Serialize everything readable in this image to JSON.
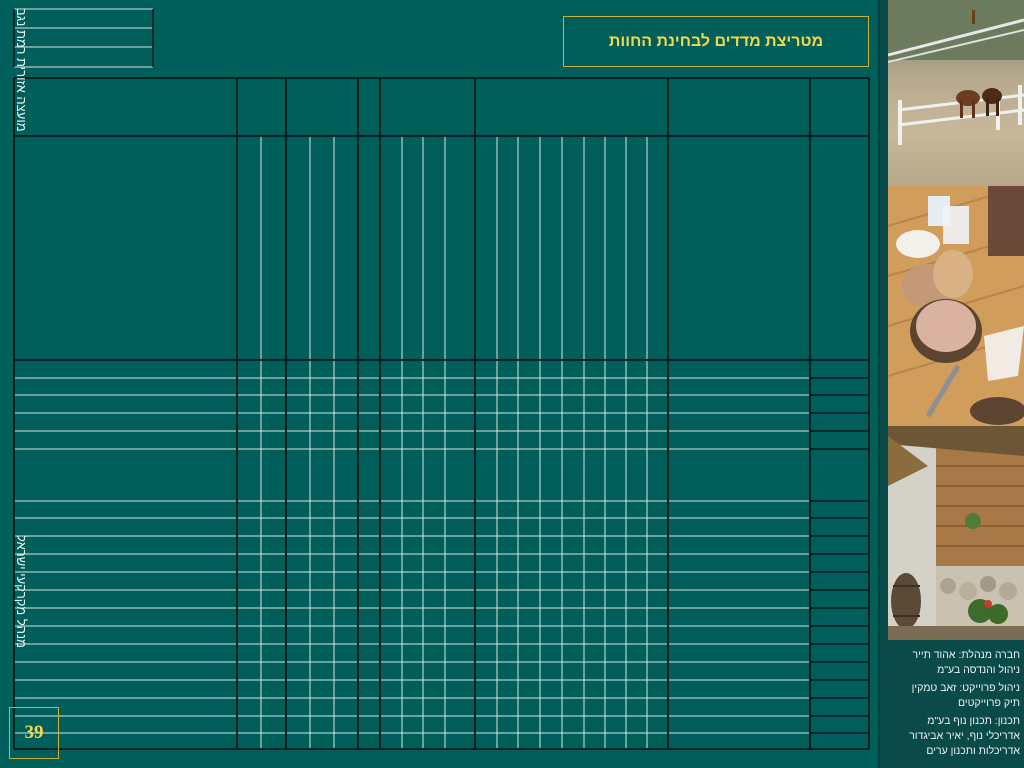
{
  "slide": {
    "title": "מטריצת מדדים לבחינת החוות",
    "page_number": "39",
    "vertical_label_top": "מועצה אזורית רמת נגב",
    "vertical_label_bottom": "מנהל מקרקעי ישראל"
  },
  "credits": {
    "management_company": "חברה מנהלת:  אהוד תייר",
    "management_company_2": "ניהול והנדסה בע\"מ",
    "project_management": "ניהול פרוייקט: זאב טמקין",
    "project_management_2": "תיק פרוייקטים",
    "planning": "תכנון:  תכנון נוף בע\"מ",
    "planning_2": "אדריכלי נוף, יאיר אביגדור",
    "planning_3": "אדריכלות ותכנון ערים"
  },
  "colors": {
    "background": "#005e5b",
    "title_text": "#f6d84a",
    "frame": "#c9b13a",
    "grid_dark": "#001a1a",
    "grid_light": "#d9e4e2"
  },
  "photos": [
    "horses-photo",
    "cheese-photo",
    "terrace-photo"
  ]
}
